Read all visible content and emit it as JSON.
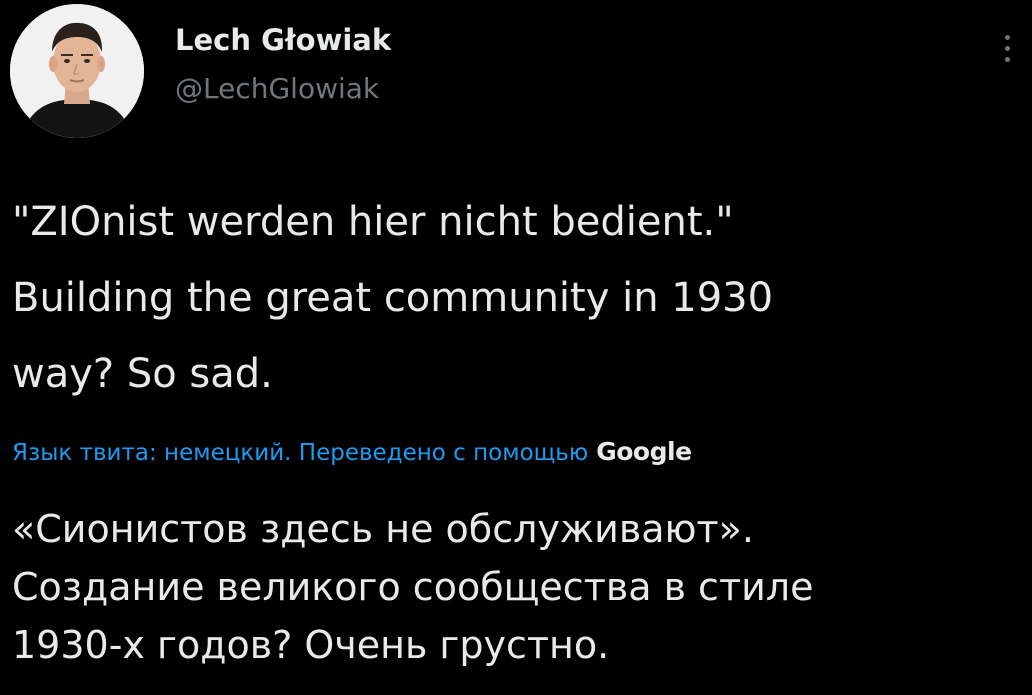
{
  "author": {
    "display_name": "Lech Głowiak",
    "handle": "@LechGlowiak",
    "avatar_icon": "user-avatar-photo"
  },
  "tweet": {
    "text_lines": [
      "\"ZIOnist werden hier nicht bedient.\"",
      "Building the great community in 1930",
      "way? So sad."
    ]
  },
  "translation": {
    "link_label": "Язык твита: немецкий. Переведено с помощью",
    "provider": "Google",
    "text_lines": [
      "«Сионистов здесь не обслуживают».",
      "Создание великого сообщества в стиле",
      "1930-х годов? Очень грустно."
    ]
  },
  "colors": {
    "background": "#000000",
    "primary_text": "#e7e9ea",
    "secondary_text": "#71767b",
    "link": "#1d9bf0"
  },
  "more_icon": "more-vertical-icon"
}
